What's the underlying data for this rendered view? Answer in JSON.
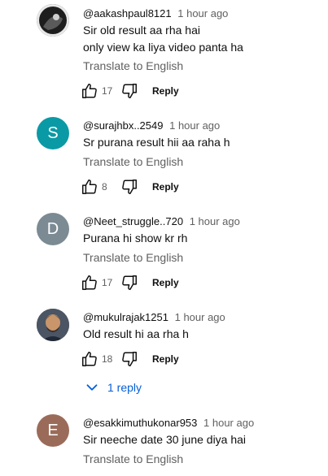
{
  "comments": [
    {
      "author": "@aakashpaul8121",
      "time": "1 hour ago",
      "lines": [
        "Sir old result aa rha hai",
        "only view ka liya video panta ha"
      ],
      "translate": "Translate to English",
      "likes": "17",
      "reply": "Reply"
    },
    {
      "author": "@surajhbx..2549",
      "time": "1 hour ago",
      "avatar_letter": "S",
      "avatar_color": "#0a9aa5",
      "lines": [
        "Sr purana result hii aa raha h"
      ],
      "translate": "Translate to English",
      "likes": "8",
      "reply": "Reply"
    },
    {
      "author": "@Neet_struggle..720",
      "time": "1 hour ago",
      "avatar_letter": "D",
      "avatar_color": "#7b8a93",
      "lines": [
        "Purana hi show kr rh"
      ],
      "translate": "Translate to English",
      "likes": "17",
      "reply": "Reply"
    },
    {
      "author": "@mukulrajak1251",
      "time": "1 hour ago",
      "lines": [
        "Old result hi aa rha h"
      ],
      "likes": "18",
      "reply": "Reply",
      "replies_label": "1 reply"
    },
    {
      "author": "@esakkimuthukonar953",
      "time": "1 hour ago",
      "avatar_letter": "E",
      "avatar_color": "#9b6b5a",
      "lines": [
        "Sir neeche date 30 june diya hai"
      ],
      "translate": "Translate to English"
    }
  ],
  "icons": {
    "like": "thumb-up-icon",
    "dislike": "thumb-down-icon",
    "expand": "chevron-down-icon"
  },
  "colors": {
    "link": "#065fd4",
    "meta": "#606060",
    "text": "#0f0f0f"
  }
}
